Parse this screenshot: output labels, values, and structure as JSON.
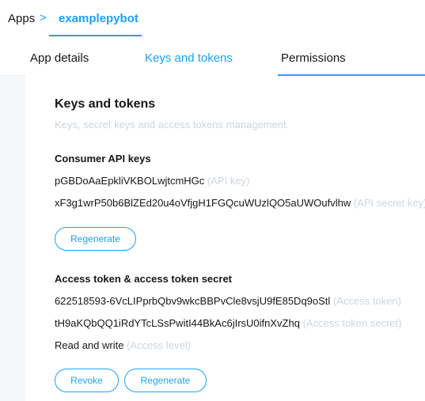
{
  "breadcrumb": {
    "root": "Apps",
    "separator": ">",
    "current": "examplepybot"
  },
  "tabs": [
    {
      "label": "App details",
      "active": false
    },
    {
      "label": "Keys and tokens",
      "active": true
    },
    {
      "label": "Permissions",
      "active": false
    }
  ],
  "header": {
    "title": "Keys and tokens",
    "subtitle": "Keys, secret keys and access tokens management."
  },
  "consumer": {
    "title": "Consumer API keys",
    "api_key": "pGBDoAaEpkliVKBOLwjtcmHGc",
    "api_key_hint": "(API key)",
    "api_secret": "xF3g1wrP50b6BlZEd20u4oVfjgH1FGQcuWUzlQO5aUWOufvlhw",
    "api_secret_hint": "(API secret key)",
    "regenerate_label": "Regenerate"
  },
  "access": {
    "title": "Access token & access token secret",
    "token": "622518593-6VcLIPprbQbv9wkcBBPvCle8vsjU9fE85Dq9oStl",
    "token_hint": "(Access token)",
    "secret": "tH9aKQbQQ1iRdYTcLSsPwitI44BkAc6jIrsU0ifnXvZhq",
    "secret_hint": "(Access token secret)",
    "level": "Read and write",
    "level_hint": "(Access level)",
    "revoke_label": "Revoke",
    "regenerate_label": "Regenerate"
  },
  "colors": {
    "accent": "#1da1f2",
    "muted": "#ccd6dd",
    "background": "#f5f8fa"
  }
}
